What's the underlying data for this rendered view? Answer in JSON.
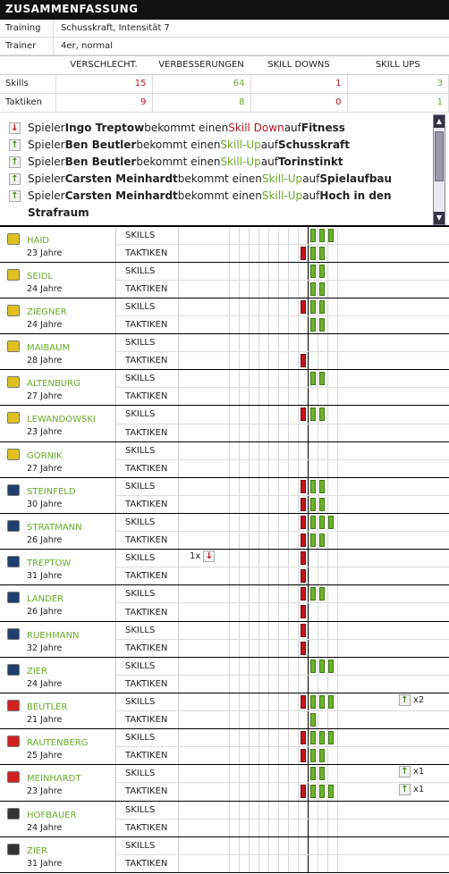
{
  "header": {
    "title": "ZUSAMMENFASSUNG"
  },
  "info": [
    {
      "k": "Training",
      "v": "Schusskraft, Intensität 7"
    },
    {
      "k": "Trainer",
      "v": "4er, normal"
    }
  ],
  "summary": {
    "cols": [
      "VERSCHLECHT.",
      "VERBESSERUNGEN",
      "SKILL DOWNS",
      "SKILL UPS"
    ],
    "rows": [
      {
        "label": "Skills",
        "vals": [
          "15",
          "64",
          "1",
          "3"
        ]
      },
      {
        "label": "Taktiken",
        "vals": [
          "9",
          "8",
          "0",
          "1"
        ]
      }
    ]
  },
  "log": [
    {
      "dir": "down",
      "pre": "Spieler ",
      "name": "Ingo Treptow",
      "mid": " bekommt einen ",
      "ev": "Skill Down",
      "post": " auf ",
      "attr": "Fitness"
    },
    {
      "dir": "up",
      "pre": "Spieler ",
      "name": "Ben Beutler",
      "mid": " bekommt einen ",
      "ev": "Skill-Up",
      "post": " auf ",
      "attr": "Schusskraft"
    },
    {
      "dir": "up",
      "pre": "Spieler ",
      "name": "Ben Beutler",
      "mid": " bekommt einen ",
      "ev": "Skill-Up",
      "post": " auf ",
      "attr": "Torinstinkt"
    },
    {
      "dir": "up",
      "pre": "Spieler ",
      "name": "Carsten Meinhardt",
      "mid": " bekommt einen ",
      "ev": "Skill-Up",
      "post": " auf ",
      "attr": "Spielaufbau"
    },
    {
      "dir": "up",
      "pre": "Spieler ",
      "name": "Carsten Meinhardt",
      "mid": " bekommt einen ",
      "ev": "Skill-Up",
      "post": " auf ",
      "attr": "Hoch in den"
    },
    {
      "dir": "none",
      "pre": "",
      "name": "",
      "mid": "",
      "ev": "",
      "post": "",
      "attr": "Strafraum"
    }
  ],
  "row_labels": {
    "skills": "SKILLS",
    "taktiken": "TAKTIKEN"
  },
  "players": [
    {
      "name": "HAID",
      "age": "23 Jahre",
      "badge": "#e0c020",
      "s": [
        0,
        3
      ],
      "t": [
        1,
        2
      ]
    },
    {
      "name": "SEIDL",
      "age": "24 Jahre",
      "badge": "#e0c020",
      "s": [
        0,
        2
      ],
      "t": [
        0,
        2
      ]
    },
    {
      "name": "ZIEGNER",
      "age": "24 Jahre",
      "badge": "#e0c020",
      "s": [
        1,
        2
      ],
      "t": [
        0,
        2
      ]
    },
    {
      "name": "MAIBAUM",
      "age": "28 Jahre",
      "badge": "#e0c020",
      "s": [
        0,
        0
      ],
      "t": [
        1,
        0
      ]
    },
    {
      "name": "ALTENBURG",
      "age": "27 Jahre",
      "badge": "#e0c020",
      "s": [
        0,
        2
      ],
      "t": [
        0,
        0
      ]
    },
    {
      "name": "LEWANDOWSKI",
      "age": "23 Jahre",
      "badge": "#e0c020",
      "s": [
        1,
        2
      ],
      "t": [
        0,
        0
      ]
    },
    {
      "name": "GORNIK",
      "age": "27 Jahre",
      "badge": "#e0c020",
      "s": [
        0,
        0
      ],
      "t": [
        0,
        0
      ]
    },
    {
      "name": "STEINFELD",
      "age": "30 Jahre",
      "badge": "#1f3f6f",
      "s": [
        1,
        2
      ],
      "t": [
        1,
        2
      ]
    },
    {
      "name": "STRATMANN",
      "age": "26 Jahre",
      "badge": "#1f3f6f",
      "s": [
        1,
        3
      ],
      "t": [
        1,
        2
      ]
    },
    {
      "name": "TREPTOW",
      "age": "31 Jahre",
      "badge": "#1f3f6f",
      "s": [
        1,
        0
      ],
      "t": [
        1,
        0
      ],
      "skill_mark": {
        "count": "1x",
        "dir": "down"
      }
    },
    {
      "name": "LANDER",
      "age": "26 Jahre",
      "badge": "#1f3f6f",
      "s": [
        1,
        2
      ],
      "t": [
        1,
        0
      ]
    },
    {
      "name": "RUEHMANN",
      "age": "32 Jahre",
      "badge": "#1f3f6f",
      "s": [
        1,
        0
      ],
      "t": [
        1,
        0
      ]
    },
    {
      "name": "ZIER",
      "age": "24 Jahre",
      "badge": "#1f3f6f",
      "s": [
        0,
        3
      ],
      "t": [
        0,
        0
      ]
    },
    {
      "name": "BEUTLER",
      "age": "21 Jahre",
      "badge": "#d02020",
      "s": [
        1,
        3
      ],
      "t": [
        0,
        1
      ],
      "skill_mark": {
        "count": "x2",
        "dir": "up"
      }
    },
    {
      "name": "RAUTENBERG",
      "age": "25 Jahre",
      "badge": "#d02020",
      "s": [
        1,
        3
      ],
      "t": [
        1,
        2
      ]
    },
    {
      "name": "MEINHARDT",
      "age": "23 Jahre",
      "badge": "#d02020",
      "s": [
        0,
        2
      ],
      "t": [
        1,
        3
      ],
      "skill_mark": {
        "count": "x1",
        "dir": "up"
      },
      "tak_mark": {
        "count": "x1",
        "dir": "up"
      }
    },
    {
      "name": "HOFBAUER",
      "age": "24 Jahre",
      "badge": "#333333",
      "s": [
        0,
        0
      ],
      "t": [
        0,
        0
      ]
    },
    {
      "name": "ZIER",
      "age": "31 Jahre",
      "badge": "#333333",
      "s": [
        0,
        0
      ],
      "t": [
        0,
        0
      ]
    }
  ]
}
